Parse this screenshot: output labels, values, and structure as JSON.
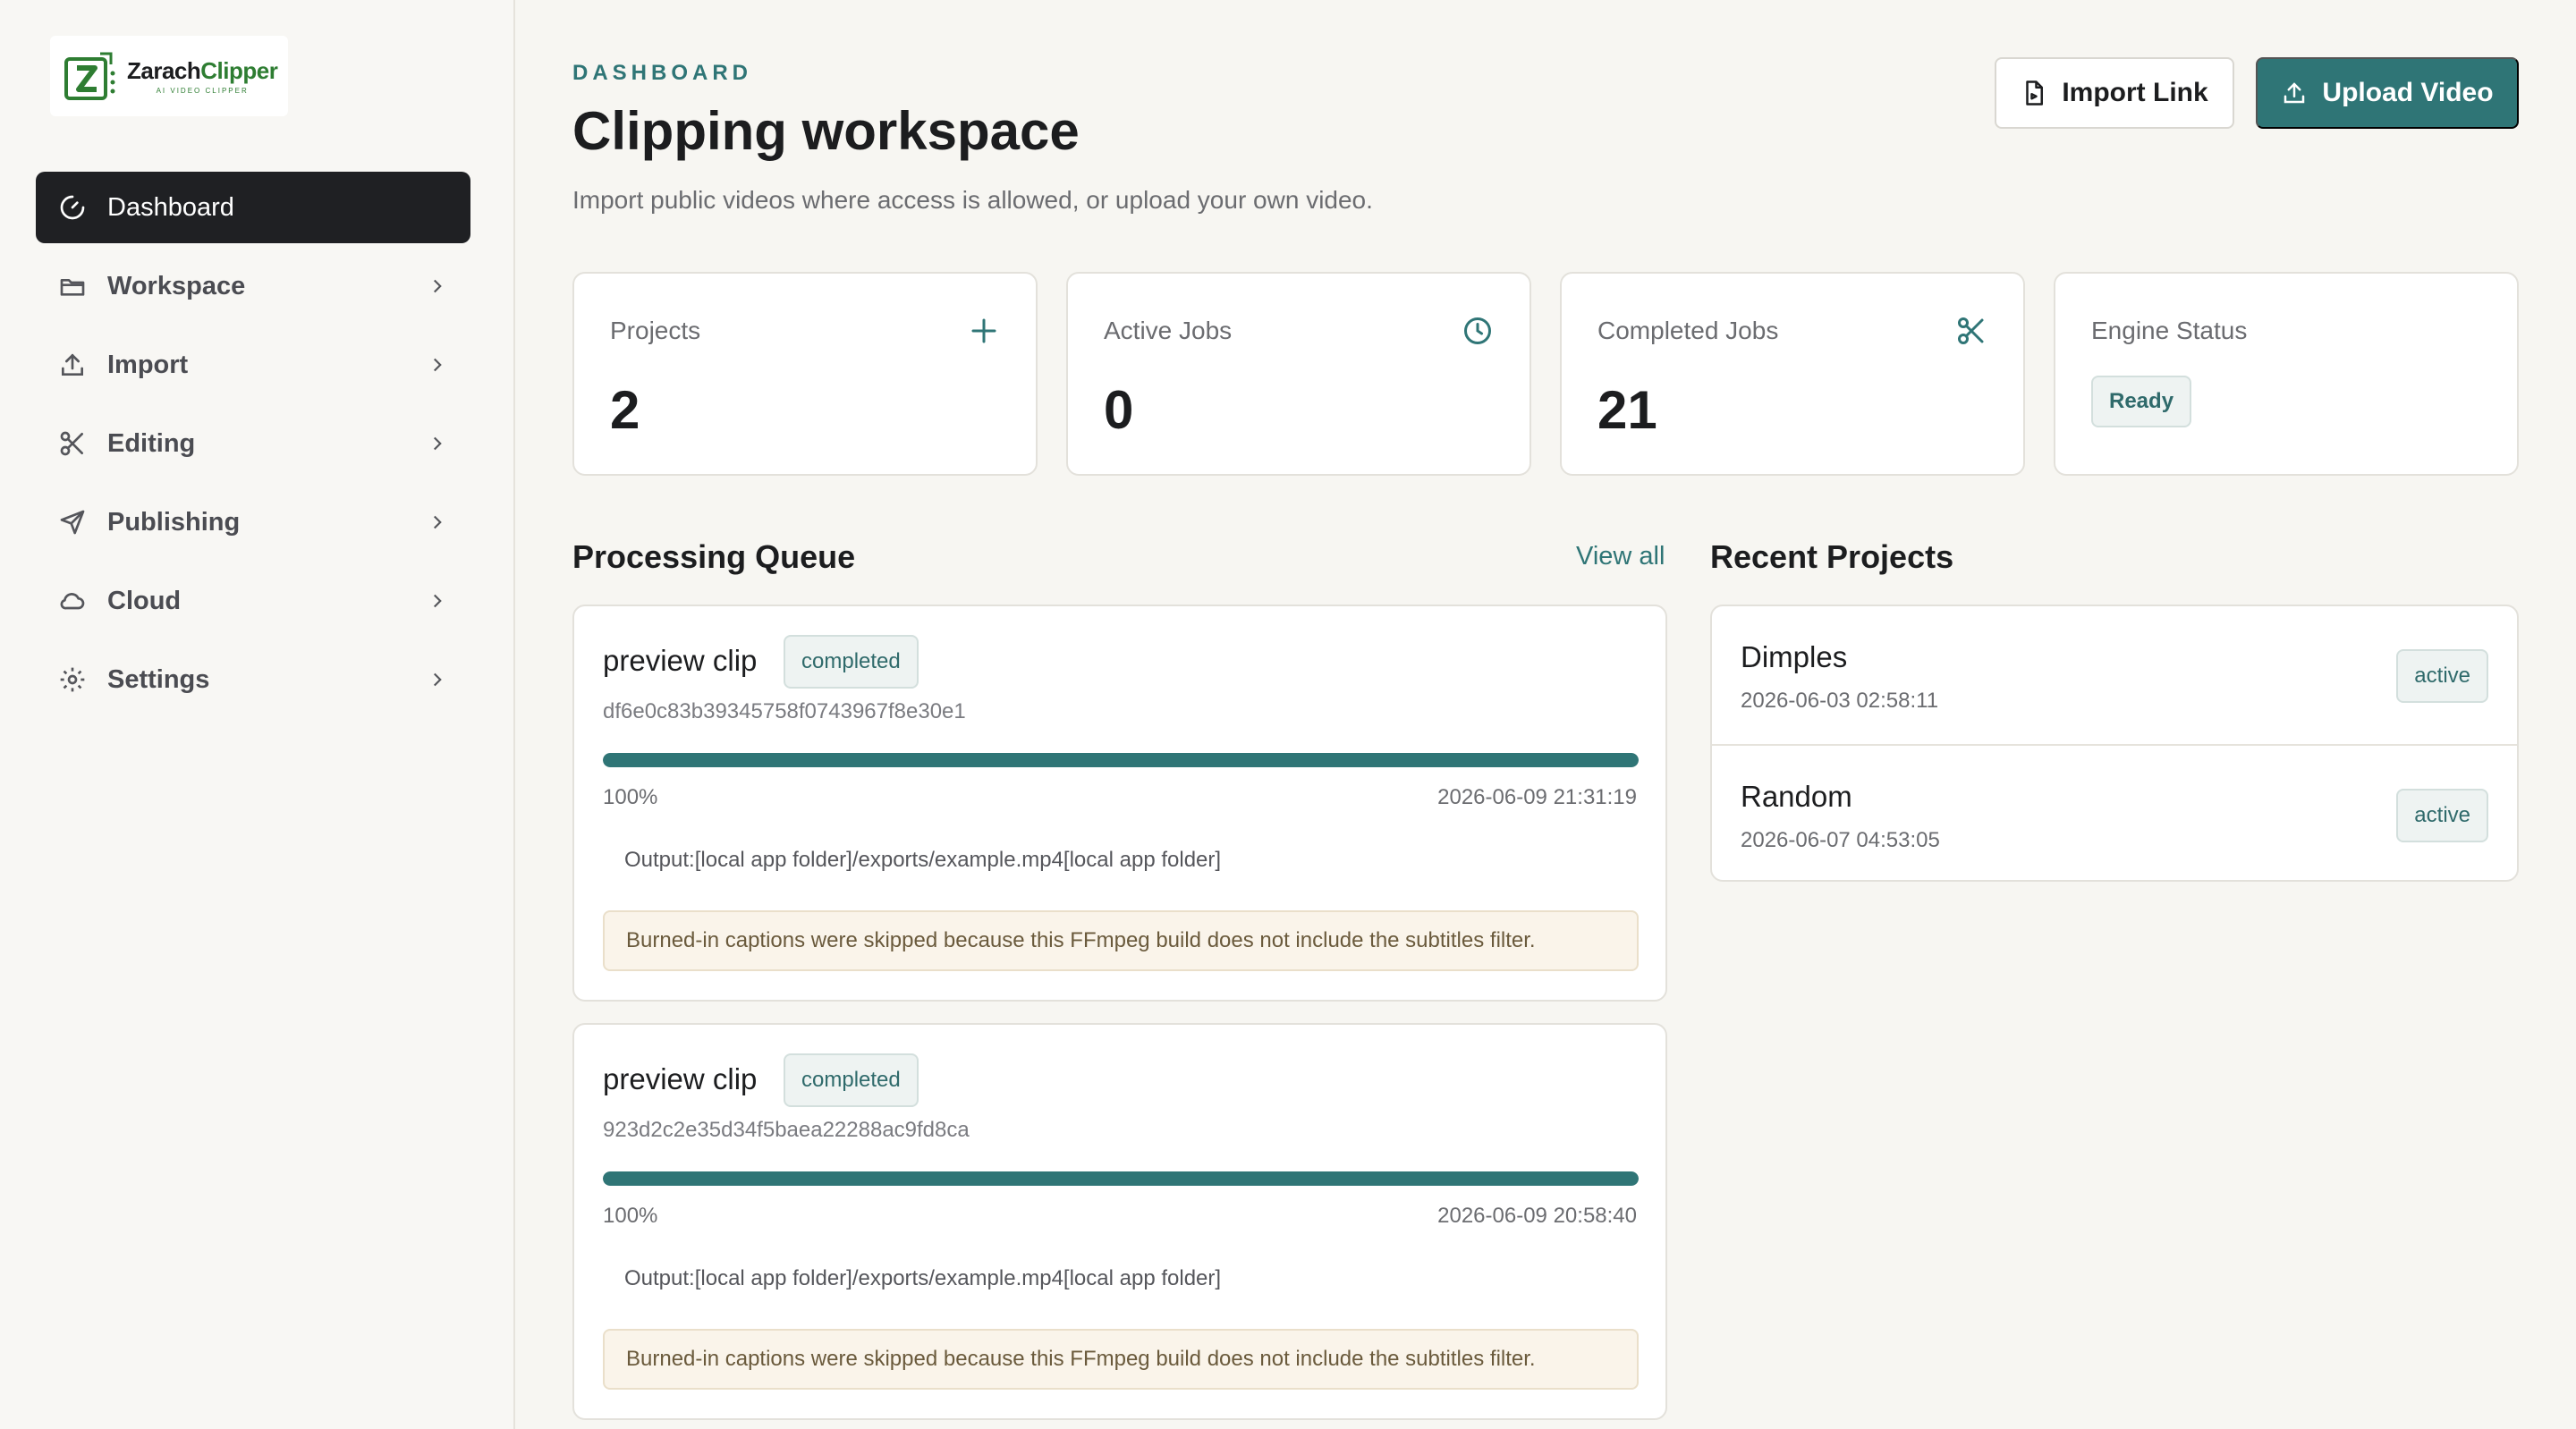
{
  "brand": {
    "name_part1": "Zarach",
    "name_part2": "Clipper",
    "tagline": "AI VIDEO CLIPPER",
    "accent": "#2f7576",
    "logo_green": "#2e7d32"
  },
  "sidebar": {
    "items": [
      {
        "label": "Dashboard",
        "icon": "gauge-icon",
        "active": true
      },
      {
        "label": "Workspace",
        "icon": "folder-icon"
      },
      {
        "label": "Import",
        "icon": "upload-icon"
      },
      {
        "label": "Editing",
        "icon": "scissors-icon"
      },
      {
        "label": "Publishing",
        "icon": "send-icon"
      },
      {
        "label": "Cloud",
        "icon": "cloud-icon"
      },
      {
        "label": "Settings",
        "icon": "gear-icon"
      }
    ]
  },
  "header": {
    "eyebrow": "DASHBOARD",
    "title": "Clipping workspace",
    "subtitle": "Import public videos where access is allowed, or upload your own video.",
    "import_label": "Import Link",
    "upload_label": "Upload Video"
  },
  "stats": {
    "projects": {
      "label": "Projects",
      "value": "2",
      "icon": "plus-icon"
    },
    "active_jobs": {
      "label": "Active Jobs",
      "value": "0",
      "icon": "clock-icon"
    },
    "completed_jobs": {
      "label": "Completed Jobs",
      "value": "21",
      "icon": "scissors-icon"
    },
    "engine": {
      "label": "Engine Status",
      "status": "Ready"
    }
  },
  "queue": {
    "title": "Processing Queue",
    "view_all": "View all",
    "jobs": [
      {
        "name": "preview clip",
        "status": "completed",
        "id": "df6e0c83b39345758f0743967f8e30e1",
        "progress": 100,
        "progress_label": "100%",
        "time": "2026-06-09 21:31:19",
        "output": "Output:[local app folder]/exports/example.mp4[local app folder]",
        "warning": "Burned-in captions were skipped because this FFmpeg build does not include the subtitles filter."
      },
      {
        "name": "preview clip",
        "status": "completed",
        "id": "923d2c2e35d34f5baea22288ac9fd8ca",
        "progress": 100,
        "progress_label": "100%",
        "time": "2026-06-09 20:58:40",
        "output": "Output:[local app folder]/exports/example.mp4[local app folder]",
        "warning": "Burned-in captions were skipped because this FFmpeg build does not include the subtitles filter."
      }
    ]
  },
  "recent": {
    "title": "Recent Projects",
    "projects": [
      {
        "name": "Dimples",
        "date": "2026-06-03 02:58:11",
        "status": "active"
      },
      {
        "name": "Random",
        "date": "2026-06-07 04:53:05",
        "status": "active"
      }
    ]
  }
}
